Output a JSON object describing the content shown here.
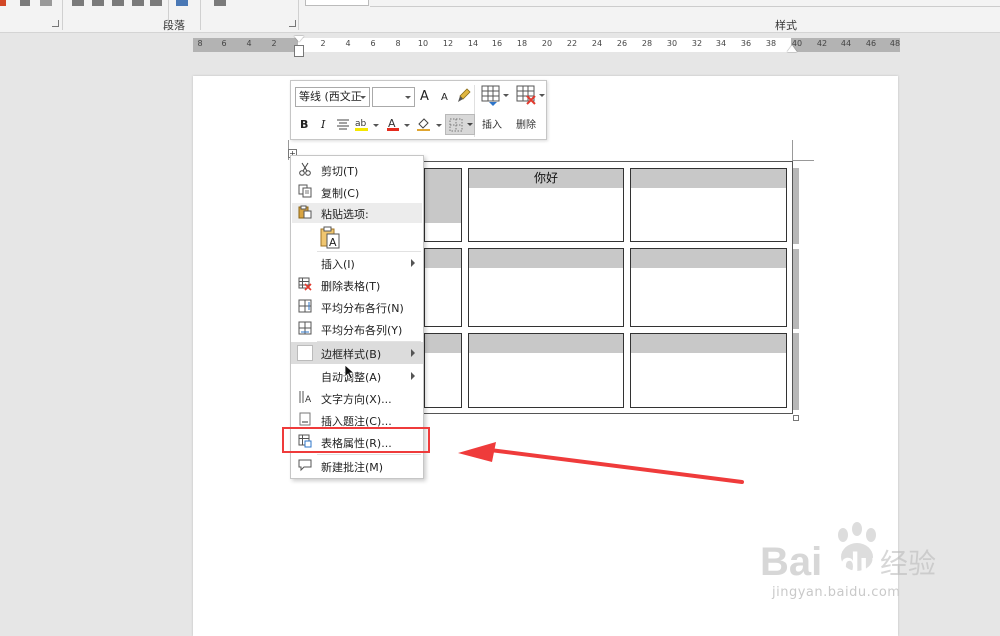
{
  "ribbon": {
    "paragraph_group_label": "段落",
    "styles_group_label": "样式"
  },
  "ruler": {
    "left_ticks": [
      "8",
      "6",
      "4",
      "2"
    ],
    "ticks": [
      "2",
      "4",
      "6",
      "8",
      "10",
      "12",
      "14",
      "16",
      "18",
      "20",
      "22",
      "24",
      "26",
      "28",
      "30",
      "32",
      "34",
      "36",
      "38"
    ],
    "right_ticks": [
      "40",
      "42",
      "44",
      "46",
      "48"
    ]
  },
  "mini_toolbar": {
    "font_name": "等线 (西文正",
    "font_size": "",
    "grow_font": "A",
    "shrink_font": "A",
    "bold": "B",
    "italic": "I",
    "insert_label": "插入",
    "delete_label": "删除"
  },
  "table": {
    "header_text": "你好"
  },
  "context_menu": {
    "items": [
      {
        "label": "剪切(T)",
        "icon": "scissors-icon"
      },
      {
        "label": "复制(C)",
        "icon": "copy-icon"
      },
      {
        "label": "粘贴选项:",
        "icon": "paste-icon"
      },
      {
        "label": "插入(I)",
        "icon": "",
        "submenu": true
      },
      {
        "label": "删除表格(T)",
        "icon": "delete-table-icon"
      },
      {
        "label": "平均分布各行(N)",
        "icon": "distribute-rows-icon"
      },
      {
        "label": "平均分布各列(Y)",
        "icon": "distribute-columns-icon"
      },
      {
        "label": "边框样式(B)",
        "icon": "border-style-icon",
        "submenu": true,
        "hover": true
      },
      {
        "label": "自动调整(A)",
        "icon": "",
        "submenu": true
      },
      {
        "label": "文字方向(X)...",
        "icon": "text-direction-icon"
      },
      {
        "label": "插入题注(C)...",
        "icon": "caption-icon"
      },
      {
        "label": "表格属性(R)...",
        "icon": "table-properties-icon"
      },
      {
        "label": "新建批注(M)",
        "icon": "new-comment-icon"
      }
    ]
  },
  "annotation": {
    "highlight_color": "#ef3b3b",
    "arrow_color": "#ef3b3b"
  },
  "watermark": {
    "brand_latin": "Bai",
    "brand_latin_2": "du",
    "brand_cn": "经验",
    "url": "jingyan.baidu.com"
  }
}
